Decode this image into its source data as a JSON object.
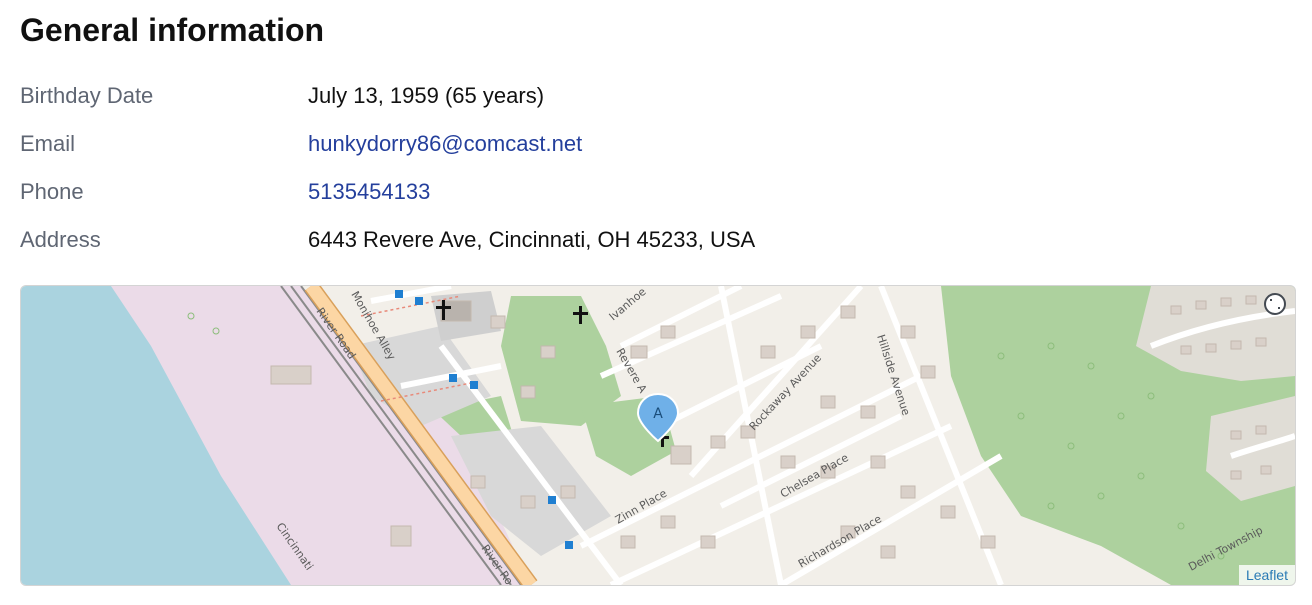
{
  "section": {
    "title": "General information"
  },
  "info": {
    "birthday_label": "Birthday Date",
    "birthday_value": "July 13, 1959 (65 years)",
    "email_label": "Email",
    "email_value": "hunkydorry86@comcast.net",
    "phone_label": "Phone",
    "phone_value": "5135454133",
    "address_label": "Address",
    "address_value": "6443 Revere Ave, Cincinnati, OH 45233, USA"
  },
  "map": {
    "marker_label": "A",
    "attribution": "Leaflet",
    "street_labels": {
      "river_road": "River Road",
      "river_road_2": "River Ro",
      "monihoe_alley": "Monihoe Alley",
      "ivanhoe": "Ivanhoe",
      "revere": "Revere A",
      "rockaway": "Rockaway Avenue",
      "hillside": "Hillside Avenue",
      "chelsea": "Chelsea Place",
      "zinn": "Zinn Place",
      "richardson": "Richardson Place",
      "delhi": "Delhi Township",
      "cincinnati": "Cincinnati"
    },
    "colors": {
      "water": "#aad3df",
      "industrial": "#ebdbe8",
      "land": "#f2efe9",
      "park": "#add19e",
      "road_major": "#fcd6a4",
      "building": "#d9d0c9",
      "marker": "#6fb0e8",
      "rail": "#8a8a8a"
    },
    "icons": [
      "cross-icon",
      "fullscreen-icon",
      "map-pin-icon",
      "bus-stop-icon"
    ]
  }
}
